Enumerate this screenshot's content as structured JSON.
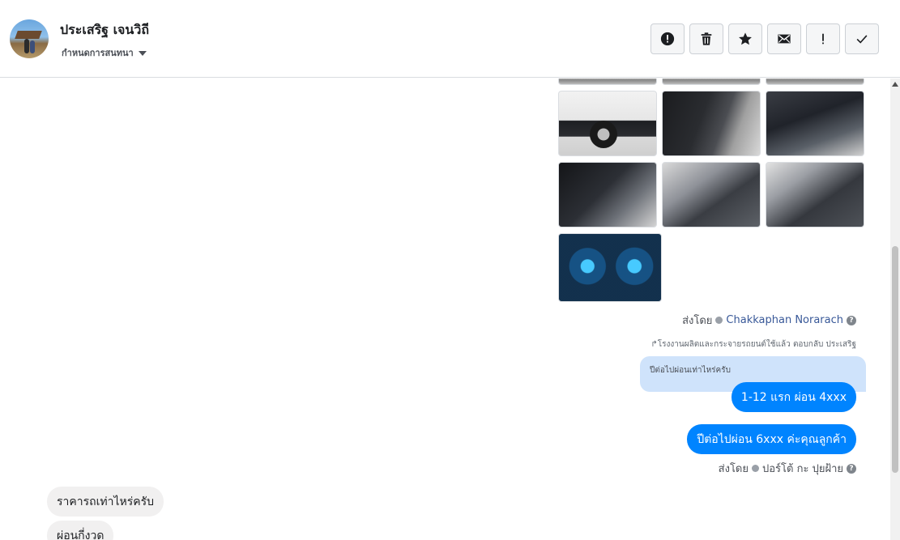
{
  "contact": {
    "name": "ประเสริฐ เจนวิถี",
    "assign_label": "กำหนดการสนทนา"
  },
  "toolbar": {
    "buttons": [
      {
        "name": "report",
        "glyph": "!"
      },
      {
        "name": "delete",
        "glyph": "trash"
      },
      {
        "name": "star",
        "glyph": "★"
      },
      {
        "name": "mark-unread",
        "glyph": "envelope"
      },
      {
        "name": "spam",
        "glyph": "!"
      },
      {
        "name": "done",
        "glyph": "✓"
      }
    ]
  },
  "thread": {
    "photo_sent_by": {
      "prefix": "ส่งโดย",
      "person": "Chakkaphan Norarach",
      "help": "?"
    },
    "reply_context": "↱โรงงานผลิตและกระจายรถยนต์ใช้แล้ว ตอบกลับ ประเสริฐ",
    "quoted_message": "ปีต่อไปผ่อนเท่าไหร่ครับ",
    "outgoing": [
      "1-12 แรก ผ่อน 4xxx",
      "ปีต่อไปผ่อน 6xxx  ค่ะคุณลูกค้า"
    ],
    "reply_sent_by": {
      "prefix": "ส่งโดย",
      "person": "ปอร์โต้ กะ ปุยฝ้าย",
      "help": "?"
    },
    "incoming": [
      "ราคารถเท่าไหร่ครับ",
      "ผ่อนกี่งวด"
    ]
  },
  "colors": {
    "accent": "#0084ff",
    "quote_bg": "#cfe3fb",
    "incoming_bg": "#f1f0f0",
    "link": "#385898"
  }
}
